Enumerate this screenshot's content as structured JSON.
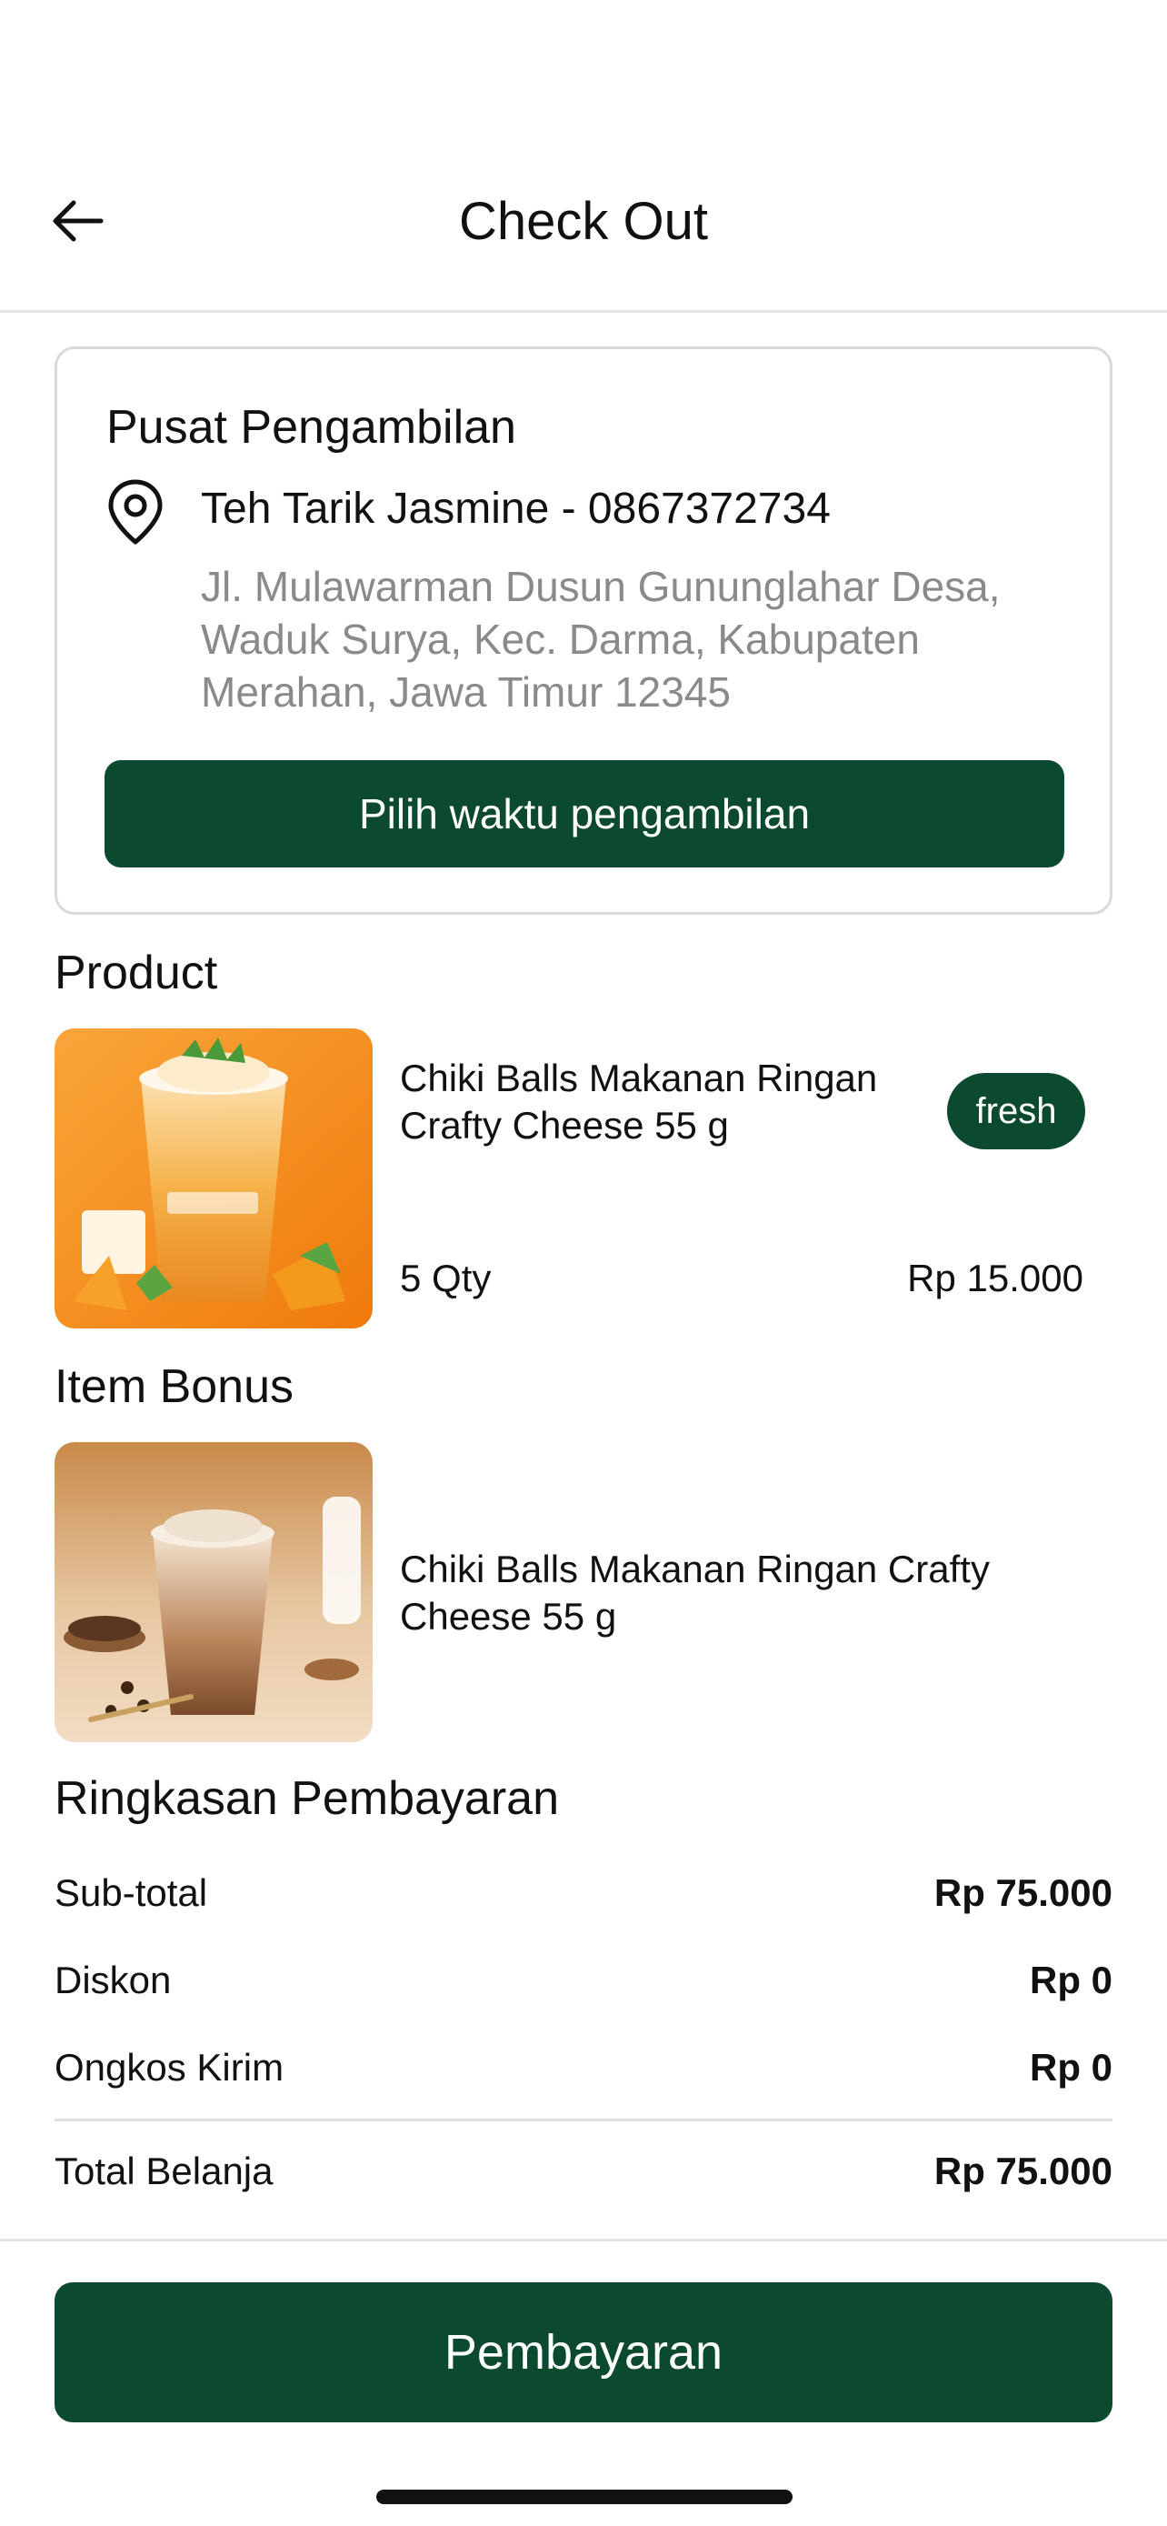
{
  "header": {
    "title": "Check Out"
  },
  "pickup": {
    "title": "Pusat Pengambilan",
    "store": "Teh Tarik Jasmine - 0867372734",
    "address": "Jl. Mulawarman Dusun Gununglahar Desa, Waduk Surya, Kec. Darma, Kabupaten Merahan, Jawa Timur 12345",
    "button_label": "Pilih waktu pengambilan"
  },
  "product": {
    "section_title": "Product",
    "name": "Chiki Balls Makanan Ringan Crafty Cheese 55 g",
    "badge": "fresh",
    "qty": "5 Qty",
    "price": "Rp 15.000"
  },
  "bonus": {
    "section_title": "Item Bonus",
    "name": "Chiki Balls Makanan Ringan Crafty Cheese 55 g"
  },
  "summary": {
    "title": "Ringkasan Pembayaran",
    "rows": [
      {
        "label": "Sub-total",
        "value": "Rp 75.000"
      },
      {
        "label": "Diskon",
        "value": "Rp 0"
      },
      {
        "label": "Ongkos Kirim",
        "value": "Rp 0"
      }
    ],
    "total": {
      "label": "Total Belanja",
      "value": "Rp 75.000"
    }
  },
  "footer": {
    "pay_label": "Pembayaran"
  },
  "icons": {
    "back": "arrow-left-icon",
    "location": "location-pin-icon"
  },
  "colors": {
    "primary": "#0b4a2e",
    "muted_text": "#8a8a8a",
    "border": "#d9d9d9"
  }
}
